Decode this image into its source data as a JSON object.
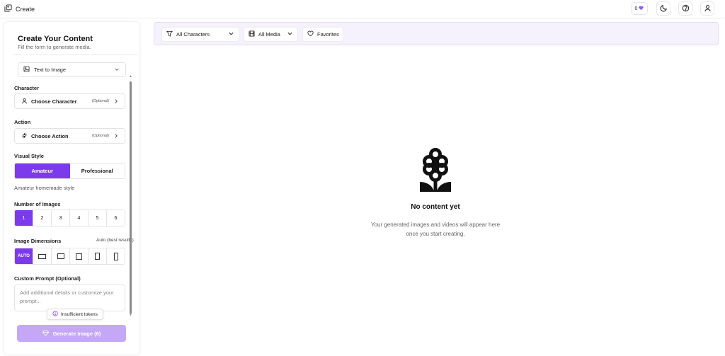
{
  "app": {
    "title": "Create"
  },
  "header": {
    "token_count": "0"
  },
  "panel": {
    "title": "Create Your Content",
    "subtitle": "Fill the form to generate media.",
    "mode_select": "Text to Image",
    "character": {
      "label": "Character",
      "value": "Choose Character",
      "note": "(Optional)"
    },
    "action": {
      "label": "Action",
      "value": "Choose Action",
      "note": "(Optional)"
    },
    "visual_style": {
      "label": "Visual Style",
      "options": [
        "Amateur",
        "Professional"
      ],
      "selected": "Amateur",
      "hint": "Amateur homemade style"
    },
    "num_images": {
      "label": "Number of Images",
      "options": [
        "1",
        "2",
        "3",
        "4",
        "5",
        "6"
      ],
      "selected": "1"
    },
    "dimensions": {
      "label": "Image Dimensions",
      "note": "Auto (best results)",
      "auto_label": "AUTO"
    },
    "custom_prompt": {
      "label": "Custom Prompt (Optional)",
      "placeholder": "Add additional details or customize your prompt..."
    },
    "tooltip": "Insufficient tokens",
    "generate_label": "Generate Image (6)"
  },
  "filters": {
    "characters": "All Characters",
    "media": "All Media",
    "favorites": "Favorites"
  },
  "empty_state": {
    "title": "No content yet",
    "description": "Your generated images and videos will appear here once you start creating."
  },
  "colors": {
    "accent": "#7c3aed",
    "accent_disabled": "#c4a8f5",
    "filter_bg": "#f6f2fd"
  }
}
